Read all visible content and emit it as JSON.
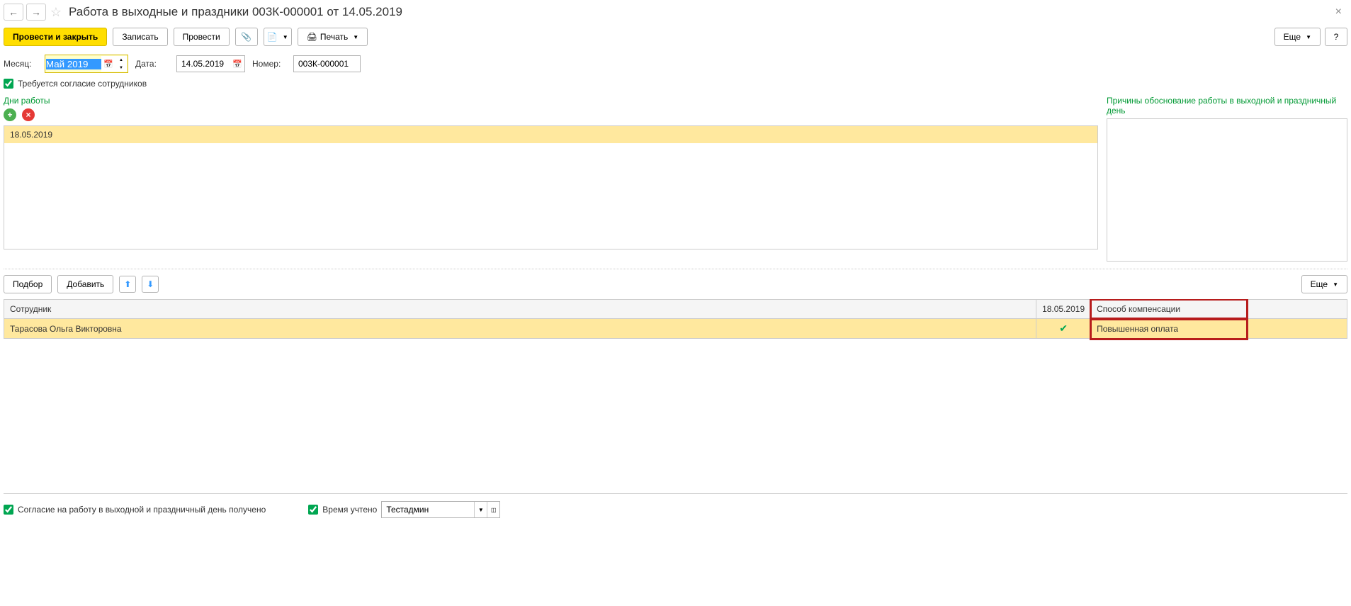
{
  "header": {
    "title": "Работа в выходные и праздники 003К-000001 от 14.05.2019"
  },
  "toolbar": {
    "post_close": "Провести и закрыть",
    "save": "Записать",
    "post": "Провести",
    "print": "Печать",
    "more": "Еще"
  },
  "form": {
    "month_label": "Месяц:",
    "month_value": "Май 2019",
    "date_label": "Дата:",
    "date_value": "14.05.2019",
    "number_label": "Номер:",
    "number_value": "003К-000001",
    "consent_label": "Требуется согласие сотрудников"
  },
  "sections": {
    "workdays_label": "Дни работы",
    "reasons_label": "Причины обоснование работы в выходной и праздничный день",
    "workdays": [
      "18.05.2019"
    ]
  },
  "lower_toolbar": {
    "select": "Подбор",
    "add": "Добавить",
    "more": "Еще"
  },
  "table": {
    "headers": {
      "employee": "Сотрудник",
      "date": "18.05.2019",
      "compensation": "Способ компенсации"
    },
    "rows": [
      {
        "employee": "Тарасова Ольга Викторовна",
        "checked": true,
        "compensation": "Повышенная оплата"
      }
    ]
  },
  "footer": {
    "consent_received": "Согласие на работу в выходной и праздничный день получено",
    "time_label": "Время учтено",
    "time_value": "Тестадмин"
  }
}
